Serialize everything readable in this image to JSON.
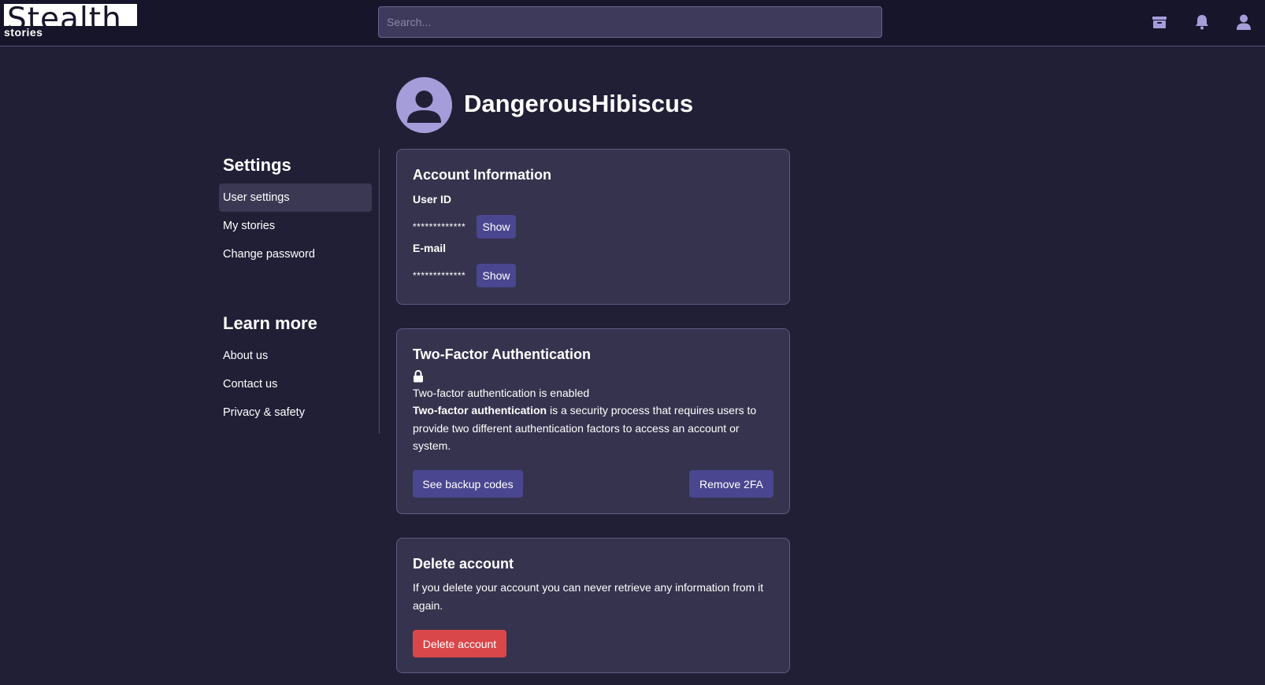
{
  "header": {
    "logo_text": "Stealth",
    "logo_subtitle": "stories",
    "search_placeholder": "Search...",
    "icons": [
      "archive-icon",
      "bell-icon",
      "user-icon"
    ]
  },
  "profile": {
    "username": "DangerousHibiscus"
  },
  "sidebar": {
    "settings_heading": "Settings",
    "settings_items": [
      {
        "label": "User settings",
        "active": true
      },
      {
        "label": "My stories",
        "active": false
      },
      {
        "label": "Change password",
        "active": false
      }
    ],
    "learn_heading": "Learn more",
    "learn_items": [
      {
        "label": "About us"
      },
      {
        "label": "Contact us"
      },
      {
        "label": "Privacy & safety"
      }
    ]
  },
  "account_info": {
    "title": "Account Information",
    "user_id_label": "User ID",
    "user_id_masked": "*************",
    "email_label": "E-mail",
    "email_masked": "*************",
    "show_label": "Show"
  },
  "two_factor": {
    "title": "Two-Factor Authentication",
    "status": "Two-factor authentication is enabled",
    "description_bold": "Two-factor authentication",
    "description_rest": " is a security process that requires users to provide two different authentication factors to access an account or system.",
    "backup_button": "See backup codes",
    "remove_button": "Remove 2FA"
  },
  "delete_account": {
    "title": "Delete account",
    "description": "If you delete your account you can never retrieve any information from it again.",
    "button": "Delete account"
  },
  "colors": {
    "background": "#211f36",
    "topbar": "#16152a",
    "card": "#36334e",
    "accent_button": "#4a468f",
    "danger_button": "#d9474a",
    "avatar": "#a59dd9",
    "icon": "#a59dd9"
  }
}
